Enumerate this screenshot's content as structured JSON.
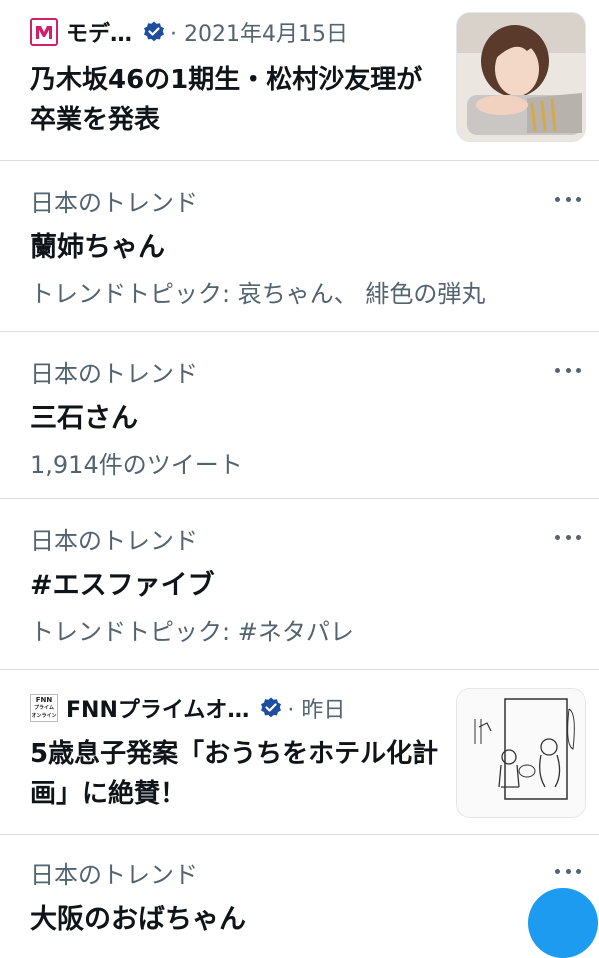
{
  "news": [
    {
      "source": "モデ…",
      "meta": "· 2021年4月15日",
      "logo_text": "modelpress",
      "headline": "乃木坂46の1期生・松村沙友理が卒業を発表",
      "thumbnail": "woman-portrait-photo"
    },
    {
      "source": "FNNプライムオ…",
      "meta": "· 昨日",
      "logo_text": "FNN プライム オンライン",
      "headline": "5歳息子発案「おうちをホテル化計画」に絶賛！",
      "thumbnail": "hand-drawn-illustration"
    }
  ],
  "trends": [
    {
      "label": "日本のトレンド",
      "title": "蘭姉ちゃん",
      "meta": "トレンドトピック: 哀ちゃん、 緋色の弾丸"
    },
    {
      "label": "日本のトレンド",
      "title": "三石さん",
      "meta": "1,914件のツイート"
    },
    {
      "label": "日本のトレンド",
      "title": "#エスファイブ",
      "meta": "トレンドトピック: #ネタパレ"
    },
    {
      "label": "日本のトレンド",
      "title": "大阪のおばちゃん",
      "meta": ""
    }
  ],
  "colors": {
    "accent": "#1d9bf0",
    "text": "#0f1419",
    "secondary": "#536471",
    "divider": "#d9dde0"
  },
  "icons": {
    "verified": "verified-badge-icon",
    "more": "more-icon",
    "compose": "compose-tweet-icon"
  }
}
